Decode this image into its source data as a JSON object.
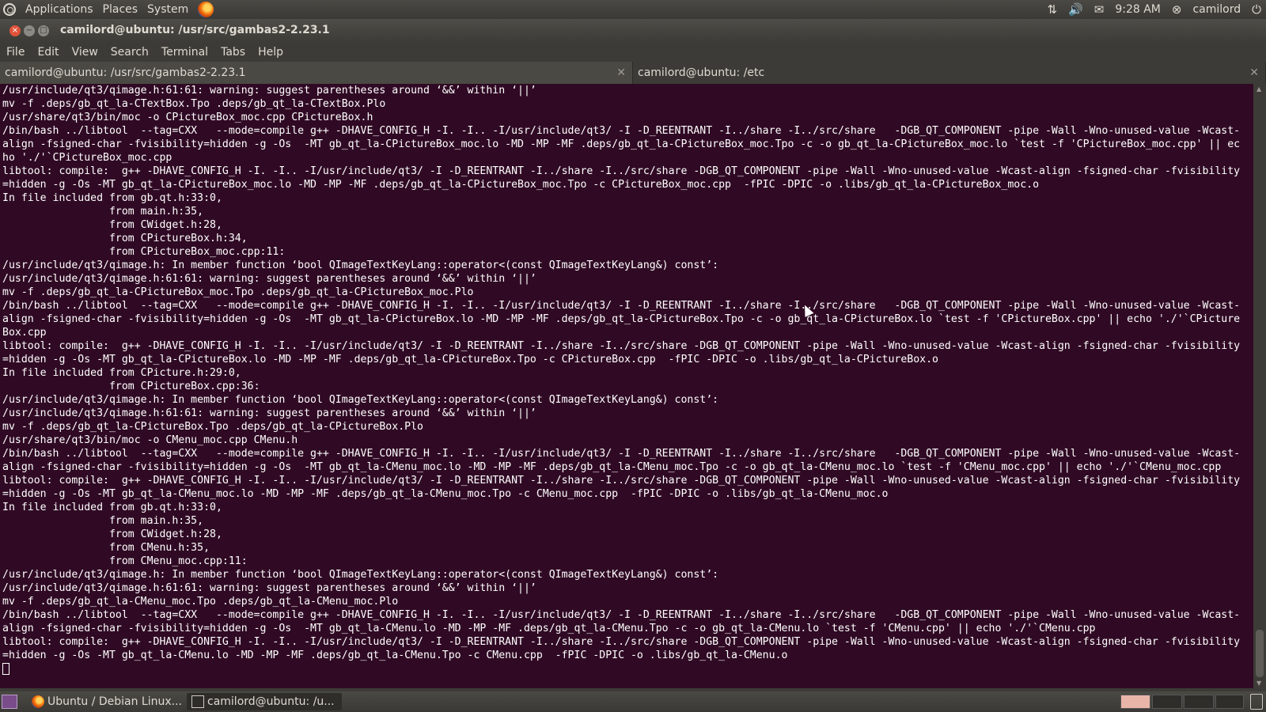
{
  "top_panel": {
    "menus": [
      "Applications",
      "Places",
      "System"
    ],
    "clock": "9:28 AM",
    "user": "camilord"
  },
  "window": {
    "title": "camilord@ubuntu: /usr/src/gambas2-2.23.1",
    "close_glyph": "×",
    "min_glyph": "−",
    "max_glyph": "□"
  },
  "menubar": [
    "File",
    "Edit",
    "View",
    "Search",
    "Terminal",
    "Tabs",
    "Help"
  ],
  "tabs": [
    {
      "label": "camilord@ubuntu: /usr/src/gambas2-2.23.1"
    },
    {
      "label": "camilord@ubuntu: /etc"
    }
  ],
  "terminal": {
    "lines": [
      "/usr/include/qt3/qimage.h:61:61: warning: suggest parentheses around ‘&&’ within ‘||’",
      "mv -f .deps/gb_qt_la-CTextBox.Tpo .deps/gb_qt_la-CTextBox.Plo",
      "/usr/share/qt3/bin/moc -o CPictureBox_moc.cpp CPictureBox.h",
      "/bin/bash ../libtool  --tag=CXX   --mode=compile g++ -DHAVE_CONFIG_H -I. -I.. -I/usr/include/qt3/ -I -D_REENTRANT -I../share -I../src/share   -DGB_QT_COMPONENT -pipe -Wall -Wno-unused-value -Wcast-",
      "align -fsigned-char -fvisibility=hidden -g -Os  -MT gb_qt_la-CPictureBox_moc.lo -MD -MP -MF .deps/gb_qt_la-CPictureBox_moc.Tpo -c -o gb_qt_la-CPictureBox_moc.lo `test -f 'CPictureBox_moc.cpp' || ec",
      "ho './'`CPictureBox_moc.cpp",
      "libtool: compile:  g++ -DHAVE_CONFIG_H -I. -I.. -I/usr/include/qt3/ -I -D_REENTRANT -I../share -I../src/share -DGB_QT_COMPONENT -pipe -Wall -Wno-unused-value -Wcast-align -fsigned-char -fvisibility",
      "=hidden -g -Os -MT gb_qt_la-CPictureBox_moc.lo -MD -MP -MF .deps/gb_qt_la-CPictureBox_moc.Tpo -c CPictureBox_moc.cpp  -fPIC -DPIC -o .libs/gb_qt_la-CPictureBox_moc.o",
      "In file included from gb.qt.h:33:0,",
      "                 from main.h:35,",
      "                 from CWidget.h:28,",
      "                 from CPictureBox.h:34,",
      "                 from CPictureBox_moc.cpp:11:",
      "/usr/include/qt3/qimage.h: In member function ‘bool QImageTextKeyLang::operator<(const QImageTextKeyLang&) const’:",
      "/usr/include/qt3/qimage.h:61:61: warning: suggest parentheses around ‘&&’ within ‘||’",
      "mv -f .deps/gb_qt_la-CPictureBox_moc.Tpo .deps/gb_qt_la-CPictureBox_moc.Plo",
      "/bin/bash ../libtool  --tag=CXX   --mode=compile g++ -DHAVE_CONFIG_H -I. -I.. -I/usr/include/qt3/ -I -D_REENTRANT -I../share -I../src/share   -DGB_QT_COMPONENT -pipe -Wall -Wno-unused-value -Wcast-",
      "align -fsigned-char -fvisibility=hidden -g -Os  -MT gb_qt_la-CPictureBox.lo -MD -MP -MF .deps/gb_qt_la-CPictureBox.Tpo -c -o gb_qt_la-CPictureBox.lo `test -f 'CPictureBox.cpp' || echo './'`CPicture",
      "Box.cpp",
      "libtool: compile:  g++ -DHAVE_CONFIG_H -I. -I.. -I/usr/include/qt3/ -I -D_REENTRANT -I../share -I../src/share -DGB_QT_COMPONENT -pipe -Wall -Wno-unused-value -Wcast-align -fsigned-char -fvisibility",
      "=hidden -g -Os -MT gb_qt_la-CPictureBox.lo -MD -MP -MF .deps/gb_qt_la-CPictureBox.Tpo -c CPictureBox.cpp  -fPIC -DPIC -o .libs/gb_qt_la-CPictureBox.o",
      "In file included from CPicture.h:29:0,",
      "                 from CPictureBox.cpp:36:",
      "/usr/include/qt3/qimage.h: In member function ‘bool QImageTextKeyLang::operator<(const QImageTextKeyLang&) const’:",
      "/usr/include/qt3/qimage.h:61:61: warning: suggest parentheses around ‘&&’ within ‘||’",
      "mv -f .deps/gb_qt_la-CPictureBox.Tpo .deps/gb_qt_la-CPictureBox.Plo",
      "/usr/share/qt3/bin/moc -o CMenu_moc.cpp CMenu.h",
      "/bin/bash ../libtool  --tag=CXX   --mode=compile g++ -DHAVE_CONFIG_H -I. -I.. -I/usr/include/qt3/ -I -D_REENTRANT -I../share -I../src/share   -DGB_QT_COMPONENT -pipe -Wall -Wno-unused-value -Wcast-",
      "align -fsigned-char -fvisibility=hidden -g -Os  -MT gb_qt_la-CMenu_moc.lo -MD -MP -MF .deps/gb_qt_la-CMenu_moc.Tpo -c -o gb_qt_la-CMenu_moc.lo `test -f 'CMenu_moc.cpp' || echo './'`CMenu_moc.cpp",
      "libtool: compile:  g++ -DHAVE_CONFIG_H -I. -I.. -I/usr/include/qt3/ -I -D_REENTRANT -I../share -I../src/share -DGB_QT_COMPONENT -pipe -Wall -Wno-unused-value -Wcast-align -fsigned-char -fvisibility",
      "=hidden -g -Os -MT gb_qt_la-CMenu_moc.lo -MD -MP -MF .deps/gb_qt_la-CMenu_moc.Tpo -c CMenu_moc.cpp  -fPIC -DPIC -o .libs/gb_qt_la-CMenu_moc.o",
      "In file included from gb.qt.h:33:0,",
      "                 from main.h:35,",
      "                 from CWidget.h:28,",
      "                 from CMenu.h:35,",
      "                 from CMenu_moc.cpp:11:",
      "/usr/include/qt3/qimage.h: In member function ‘bool QImageTextKeyLang::operator<(const QImageTextKeyLang&) const’:",
      "/usr/include/qt3/qimage.h:61:61: warning: suggest parentheses around ‘&&’ within ‘||’",
      "mv -f .deps/gb_qt_la-CMenu_moc.Tpo .deps/gb_qt_la-CMenu_moc.Plo",
      "/bin/bash ../libtool  --tag=CXX   --mode=compile g++ -DHAVE_CONFIG_H -I. -I.. -I/usr/include/qt3/ -I -D_REENTRANT -I../share -I../src/share   -DGB_QT_COMPONENT -pipe -Wall -Wno-unused-value -Wcast-",
      "align -fsigned-char -fvisibility=hidden -g -Os  -MT gb_qt_la-CMenu.lo -MD -MP -MF .deps/gb_qt_la-CMenu.Tpo -c -o gb_qt_la-CMenu.lo `test -f 'CMenu.cpp' || echo './'`CMenu.cpp",
      "libtool: compile:  g++ -DHAVE_CONFIG_H -I. -I.. -I/usr/include/qt3/ -I -D_REENTRANT -I../share -I../src/share -DGB_QT_COMPONENT -pipe -Wall -Wno-unused-value -Wcast-align -fsigned-char -fvisibility",
      "=hidden -g -Os -MT gb_qt_la-CMenu.lo -MD -MP -MF .deps/gb_qt_la-CMenu.Tpo -c CMenu.cpp  -fPIC -DPIC -o .libs/gb_qt_la-CMenu.o"
    ]
  },
  "taskbar": {
    "items": [
      {
        "label": "Ubuntu / Debian Linux...",
        "icon": "firefox-icon"
      },
      {
        "label": "camilord@ubuntu: /u...",
        "icon": "terminal-icon"
      }
    ]
  },
  "colors": {
    "terminal_bg": "#300a24",
    "panel_bg": "#3c3b37",
    "close_button": "#e0533a"
  }
}
